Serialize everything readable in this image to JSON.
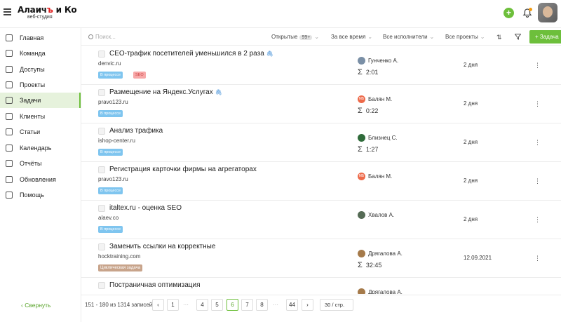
{
  "header": {
    "logo_name_a": "Алаич",
    "logo_name_b": "ъ",
    "logo_name_c": "и Ко",
    "logo_sub": "веб-студия",
    "add_icon": "plus-circle-icon",
    "bell_icon": "bell-icon"
  },
  "sidebar": {
    "items": [
      {
        "label": "Главная",
        "icon": "home-icon"
      },
      {
        "label": "Команда",
        "icon": "team-icon"
      },
      {
        "label": "Доступы",
        "icon": "key-icon"
      },
      {
        "label": "Проекты",
        "icon": "folder-icon"
      },
      {
        "label": "Задачи",
        "icon": "tasks-icon"
      },
      {
        "label": "Клиенты",
        "icon": "handshake-icon"
      },
      {
        "label": "Статьи",
        "icon": "article-icon"
      },
      {
        "label": "Календарь",
        "icon": "calendar-icon"
      },
      {
        "label": "Отчёты",
        "icon": "chart-icon"
      },
      {
        "label": "Обновления",
        "icon": "bulb-icon"
      },
      {
        "label": "Помощь",
        "icon": "globe-icon"
      }
    ],
    "active": "Задачи",
    "collapse_label": "‹ Свернуть"
  },
  "filters": {
    "search_placeholder": "Поиск...",
    "status": "Открытые",
    "status_count": "99+",
    "period": "За все время",
    "assignees": "Все исполнители",
    "projects": "Все проекты",
    "new_task": "+ Задача"
  },
  "tasks": [
    {
      "title": "СЕО-трафик посетителей уменьшился в 2 раза",
      "attachment": true,
      "site": "denvic.ru",
      "tags": [
        {
          "text": "В процессе",
          "color": "blue"
        },
        {
          "text": "SEO",
          "color": "red"
        }
      ],
      "assignee": "Гунченко А.",
      "time": "2:01",
      "due": "2 дня"
    },
    {
      "title": "Размещение на Яндекс.Услугах",
      "attachment": true,
      "site": "pravo123.ru",
      "tags": [
        {
          "text": "В процессе",
          "color": "blue"
        }
      ],
      "assignee": "Балян М.",
      "assignee_initials": "МБ",
      "time": "0:22",
      "due": "2 дня"
    },
    {
      "title": "Анализ трафика",
      "attachment": false,
      "site": "ishop-center.ru",
      "tags": [
        {
          "text": "В процессе",
          "color": "blue"
        }
      ],
      "assignee": "Близнец С.",
      "time": "1:27",
      "due": "2 дня"
    },
    {
      "title": "Регистрация карточки фирмы на агрегаторах",
      "attachment": false,
      "site": "pravo123.ru",
      "tags": [
        {
          "text": "В процессе",
          "color": "blue"
        }
      ],
      "assignee": "Балян М.",
      "assignee_initials": "МБ",
      "time": "",
      "due": "2 дня"
    },
    {
      "title": "italtex.ru - оценка SEO",
      "attachment": false,
      "site": "alaev.co",
      "tags": [
        {
          "text": "В процессе",
          "color": "blue"
        }
      ],
      "assignee": "Хвалов А.",
      "time": "",
      "due": "2 дня"
    },
    {
      "title": "Заменить ссылки на корректные",
      "attachment": false,
      "site": "hocktraining.com",
      "tags": [
        {
          "text": "Циклическая задача",
          "color": "brown"
        }
      ],
      "assignee": "Дрягалова А.",
      "time": "32:45",
      "due": "12.09.2021"
    },
    {
      "title": "Постраничная оптимизация",
      "attachment": false,
      "site": "",
      "tags": [],
      "assignee": "Дрягалова А.",
      "time": "",
      "due": ""
    }
  ],
  "pagination": {
    "summary": "151 - 180 из 1314 записей",
    "prev": "‹",
    "next": "›",
    "pages": [
      "1",
      "4",
      "5",
      "6",
      "7",
      "8",
      "44"
    ],
    "ellipsis": "···",
    "current": "6",
    "per_page": "30 / стр."
  },
  "colors": {
    "accent": "#6dbf3b",
    "tag_blue": "#7fc5ef",
    "tag_red": "#f7a8a8",
    "tag_brown": "#c8a48b",
    "assignee_mb": "#ee6a4a"
  }
}
